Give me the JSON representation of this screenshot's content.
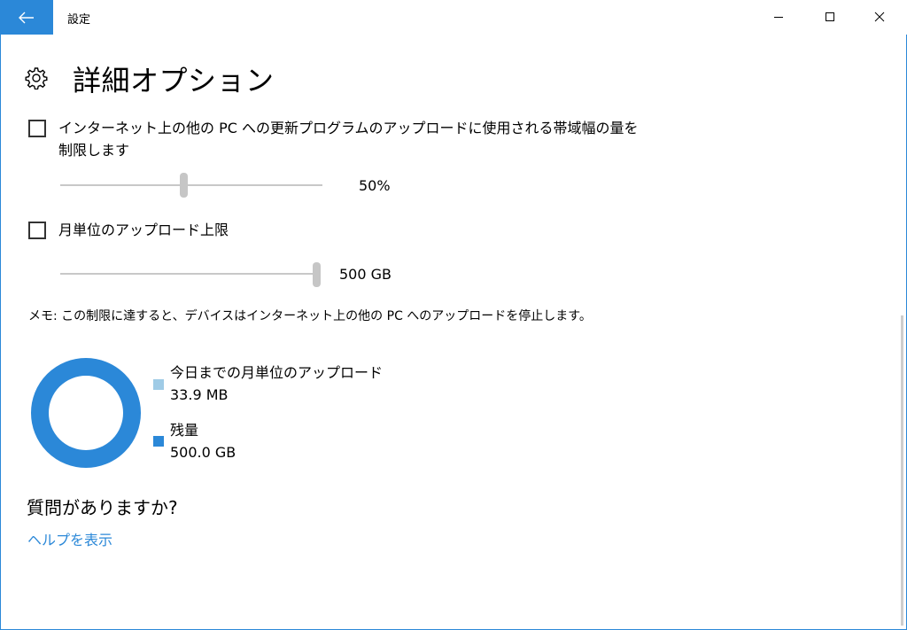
{
  "titlebar": {
    "app_title": "設定",
    "back_icon": "back-arrow-icon",
    "minimize_icon": "minimize-icon",
    "maximize_icon": "maximize-icon",
    "close_icon": "close-icon"
  },
  "header": {
    "icon": "gear-icon",
    "title": "詳細オプション"
  },
  "options": [
    {
      "checked": false,
      "label": "インターネット上の他の PC への更新プログラムのアップロードに使用される帯域幅の量を制限します",
      "slider_value_percent": 50,
      "value_text": "50%"
    },
    {
      "checked": false,
      "label": "月単位のアップロード上限",
      "slider_value_percent": 100,
      "value_text": "500 GB"
    }
  ],
  "note": "メモ: この制限に達すると、デバイスはインターネット上の他の PC へのアップロードを停止します。",
  "usage": {
    "legend": [
      {
        "label": "今日までの月単位のアップロード",
        "value": "33.9 MB",
        "color": "#9fcbe6"
      },
      {
        "label": "残量",
        "value": "500.0 GB",
        "color": "#2b88d8"
      }
    ]
  },
  "help": {
    "question": "質問がありますか?",
    "link": "ヘルプを表示"
  },
  "colors": {
    "accent": "#2b88d8",
    "light_accent": "#9fcbe6"
  }
}
